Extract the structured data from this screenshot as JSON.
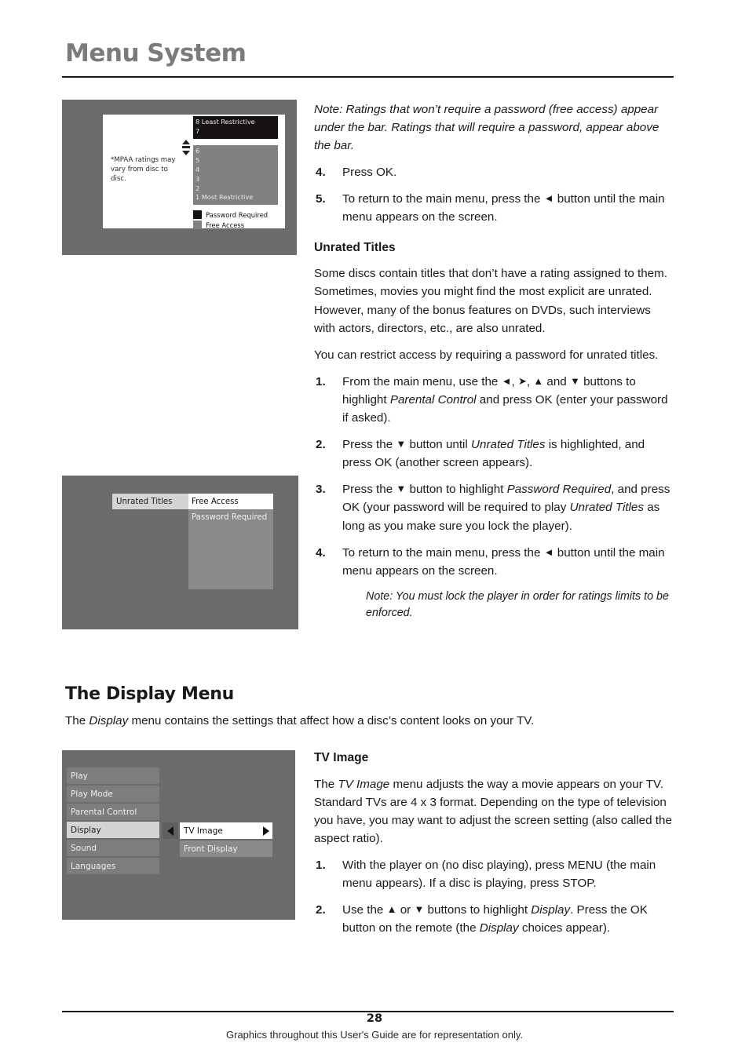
{
  "header": {
    "title": "Menu System"
  },
  "figures": {
    "ratings": {
      "mpaa_note": "*MPAA ratings may vary from disc to disc.",
      "password_rows": [
        "8 Least Restrictive",
        "7"
      ],
      "free_rows": [
        "6",
        "5",
        "4",
        "3",
        "2",
        "1 Most Restrictive"
      ],
      "legend": [
        {
          "label": "Password Required",
          "color": "#161212"
        },
        {
          "label": "Free Access",
          "color": "#818181"
        }
      ]
    },
    "unrated": {
      "menu_label": "Unrated Titles",
      "options": [
        {
          "label": "Free Access",
          "selected": true
        },
        {
          "label": "Password Required",
          "selected": false
        }
      ]
    },
    "display_menu": {
      "items": [
        {
          "label": "Play",
          "selected": false
        },
        {
          "label": "Play Mode",
          "selected": false
        },
        {
          "label": "Parental Control",
          "selected": false
        },
        {
          "label": "Display",
          "selected": true
        },
        {
          "label": "Sound",
          "selected": false
        },
        {
          "label": "Languages",
          "selected": false
        }
      ],
      "submenu": [
        {
          "label": "TV Image",
          "selected": true
        },
        {
          "label": "Front Display",
          "selected": false
        }
      ]
    }
  },
  "content": {
    "note_ratings": "Note: Ratings that won’t require a password (free access) appear under the bar. Ratings that will require a password, appear above the bar.",
    "step4_a": "Press OK.",
    "step5_a_pre": "To return to the main menu, press the",
    "step5_a_post": "button until the main menu appears on the screen.",
    "unrated_heading": "Unrated Titles",
    "unrated_p1": "Some discs contain titles that don’t have a rating assigned to them. Sometimes, movies you might find the most explicit are unrated.  However, many of the bonus features on DVDs, such interviews with actors, directors, etc., are also unrated.",
    "unrated_p2": "You can restrict access by requiring a password for unrated titles.",
    "u_step1_pre": "From the main menu, use the",
    "u_step1_mid": "buttons to highlight",
    "u_step1_italic": "Parental Control",
    "u_step1_post": "and press OK (enter your password if asked).",
    "u_step2_pre": "Press the",
    "u_step2_mid": "button until",
    "u_step2_italic": "Unrated Titles",
    "u_step2_post": "is highlighted, and press OK (another screen appears).",
    "u_step3_pre": "Press the",
    "u_step3_mid": "button to highlight",
    "u_step3_italic": "Password Required",
    "u_step3_post": ", and press OK (your password will be required to play",
    "u_step3_italic2": "Unrated Titles",
    "u_step3_post2": "as long as you make sure you lock the player).",
    "u_step4_pre": "To return to the main menu, press the",
    "u_step4_post": "button until the main menu appears on the screen.",
    "u_note": "Note: You must lock the player in order for ratings limits to be enforced.",
    "display_heading": "The Display Menu",
    "display_lead_pre": "The",
    "display_lead_italic": "Display",
    "display_lead_post": "menu contains the settings that affect how a disc’s content looks on your TV.",
    "tvimage_heading": "TV Image",
    "tvimage_p1_pre": "The",
    "tvimage_p1_italic": "TV Image",
    "tvimage_p1_post": "menu adjusts the way a movie appears on your TV. Standard TVs are 4 x 3 format. Depending on the type of television you have, you may want to adjust the screen setting (also called the aspect ratio).",
    "t_step1": "With the player on (no disc playing), press MENU (the main menu appears). If a disc is playing, press STOP.",
    "t_step2_pre": "Use the",
    "t_step2_or": "or",
    "t_step2_mid": "buttons to highlight",
    "t_step2_italic": "Display",
    "t_step2_post": ". Press the OK button on the remote (the",
    "t_step2_italic2": "Display",
    "t_step2_post2": "choices appear).",
    "num1": "1.",
    "num2": "2.",
    "num3": "3.",
    "num4": "4.",
    "num5": "5."
  },
  "footer": {
    "page_number": "28",
    "note": "Graphics throughout this User's Guide are for representation only."
  }
}
